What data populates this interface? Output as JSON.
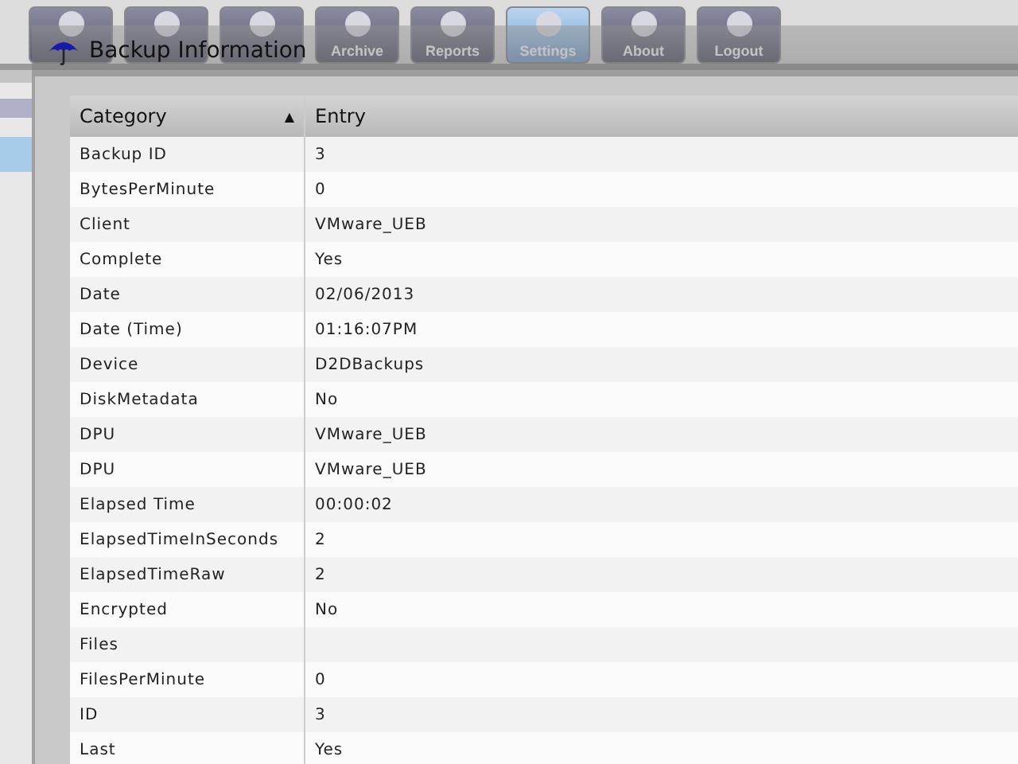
{
  "toolbar": [
    {
      "selected": false
    },
    {
      "selected": false
    },
    {
      "selected": false
    },
    {
      "label": "Archive",
      "selected": false
    },
    {
      "label": "Reports",
      "selected": false
    },
    {
      "label": "Settings",
      "selected": true
    },
    {
      "label": "About",
      "selected": false
    },
    {
      "label": "Logout",
      "selected": false
    }
  ],
  "dialog": {
    "title": "Backup Information"
  },
  "table": {
    "columns": [
      {
        "label": "Category",
        "sorted": true
      },
      {
        "label": "Entry",
        "sorted": false
      }
    ],
    "sort_indicator": "▲",
    "rows": [
      [
        "Backup ID",
        "3"
      ],
      [
        "BytesPerMinute",
        "0"
      ],
      [
        "Client",
        "VMware_UEB"
      ],
      [
        "Complete",
        "Yes"
      ],
      [
        "Date",
        "02/06/2013"
      ],
      [
        "Date (Time)",
        "01:16:07PM"
      ],
      [
        "Device",
        "D2DBackups"
      ],
      [
        "DiskMetadata",
        "No"
      ],
      [
        "DPU",
        "VMware_UEB"
      ],
      [
        "DPU",
        "VMware_UEB"
      ],
      [
        "Elapsed Time",
        "00:00:02"
      ],
      [
        "ElapsedTimeInSeconds",
        "2"
      ],
      [
        "ElapsedTimeRaw",
        "2"
      ],
      [
        "Encrypted",
        "No"
      ],
      [
        "Files",
        ""
      ],
      [
        "FilesPerMinute",
        "0"
      ],
      [
        "ID",
        "3"
      ],
      [
        "Last",
        "Yes"
      ]
    ]
  }
}
